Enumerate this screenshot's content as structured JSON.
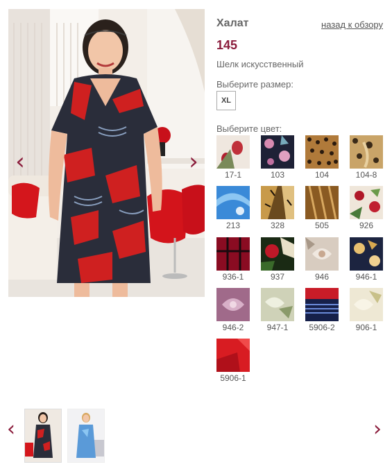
{
  "product": {
    "title": "Халат",
    "back_link": "назад к обзору",
    "price": "145",
    "material": "Шелк искусственный",
    "size_label": "Выберите размер:",
    "sizes": [
      "XL"
    ],
    "color_label": "Выберите цвет:"
  },
  "gallery": {
    "prev_icon": "chevron-left-icon",
    "next_icon": "chevron-right-icon",
    "accent_color": "#8b1d3c"
  },
  "swatches": [
    {
      "code": "17-1"
    },
    {
      "code": "103"
    },
    {
      "code": "104"
    },
    {
      "code": "104-8"
    },
    {
      "code": "213"
    },
    {
      "code": "328"
    },
    {
      "code": "505"
    },
    {
      "code": "926"
    },
    {
      "code": "936-1"
    },
    {
      "code": "937"
    },
    {
      "code": "946"
    },
    {
      "code": "946-1"
    },
    {
      "code": "946-2"
    },
    {
      "code": "947-1"
    },
    {
      "code": "5906-2"
    },
    {
      "code": "906-1"
    },
    {
      "code": "5906-1"
    }
  ]
}
